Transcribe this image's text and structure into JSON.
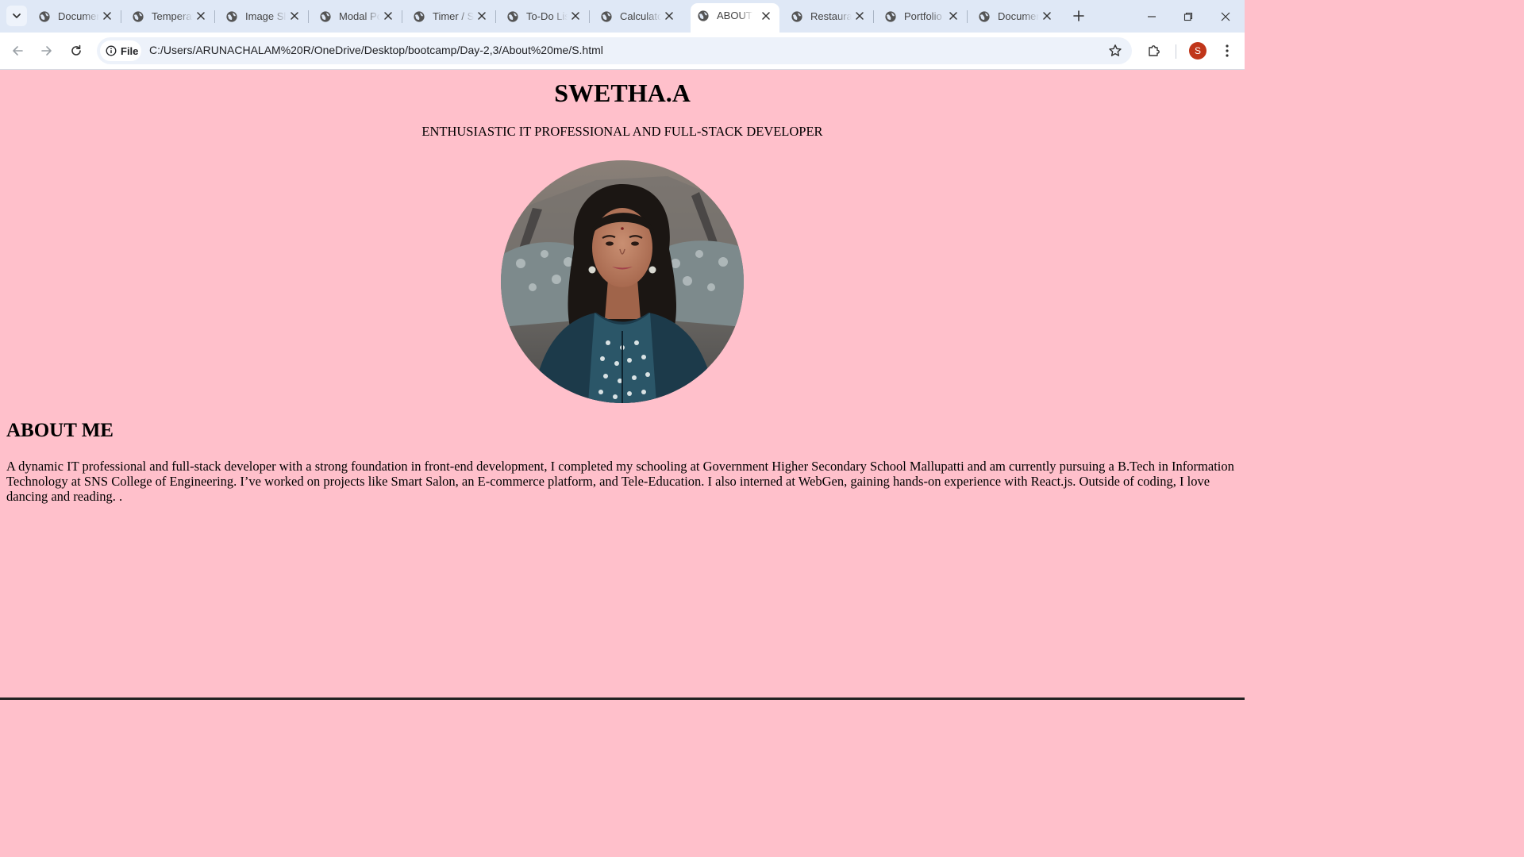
{
  "browser": {
    "tabs": [
      {
        "title": "Document",
        "active": false
      },
      {
        "title": "Temperature Converter",
        "active": false
      },
      {
        "title": "Image Slider",
        "active": false
      },
      {
        "title": "Modal Popup",
        "active": false
      },
      {
        "title": "Timer / Stopwatch",
        "active": false
      },
      {
        "title": "To-Do List",
        "active": false
      },
      {
        "title": "Calculator",
        "active": false
      },
      {
        "title": "ABOUT ME",
        "active": true
      },
      {
        "title": "Restaurant",
        "active": false
      },
      {
        "title": "Portfolio",
        "active": false
      },
      {
        "title": "Document",
        "active": false
      }
    ],
    "address_bar": {
      "scheme_label": "File",
      "url": "C:/Users/ARUNACHALAM%20R/OneDrive/Desktop/bootcamp/Day-2,3/About%20me/S.html"
    },
    "profile_initial": "S",
    "accent_color": "#c0361a"
  },
  "page": {
    "background_color": "#ffc0cb",
    "name": "SWETHA.A",
    "tagline": "ENTHUSIASTIC IT PROFESSIONAL AND FULL-STACK DEVELOPER",
    "about_heading": "ABOUT ME",
    "about_text": "A dynamic IT professional and full-stack developer with a strong foundation in front-end development, I completed my schooling at Government Higher Secondary School Mallupatti and am currently pursuing a B.Tech in Information Technology at SNS College of Engineering. I’ve worked on projects like Smart Salon, an E-commerce platform, and Tele-Education. I also interned at WebGen, gaining hands-on experience with React.js. Outside of coding, I love dancing and reading. ."
  }
}
